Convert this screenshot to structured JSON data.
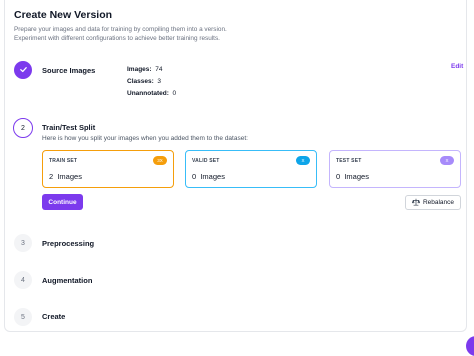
{
  "header": {
    "title": "Create New Version",
    "subtitle_line1": "Prepare your images and data for training by compiling them into a version.",
    "subtitle_line2": "Experiment with different configurations to achieve better training results."
  },
  "steps": {
    "source": {
      "name": "Source Images",
      "edit_label": "Edit",
      "stats": [
        {
          "label": "Images:",
          "value": "74"
        },
        {
          "label": "Classes:",
          "value": "3"
        },
        {
          "label": "Unannotated:",
          "value": "0"
        }
      ]
    },
    "split": {
      "number": "2",
      "name": "Train/Test Split",
      "description": "Here is how you split your images when you added them to the dataset:",
      "sets": [
        {
          "label": "TRAIN SET",
          "badge": "3X",
          "value": "2",
          "unit": "Images",
          "color": "#f59e0b",
          "badge_color": "#f59e0b"
        },
        {
          "label": "VALID SET",
          "badge": "X",
          "value": "0",
          "unit": "Images",
          "color": "#38bdf8",
          "badge_color": "#0ea5e9"
        },
        {
          "label": "TEST SET",
          "badge": "X",
          "value": "0",
          "unit": "Images",
          "color": "#c4b5fd",
          "badge_color": "#a78bfa"
        }
      ],
      "continue_label": "Continue",
      "rebalance_label": "Rebalance"
    },
    "preprocessing": {
      "number": "3",
      "name": "Preprocessing"
    },
    "augmentation": {
      "number": "4",
      "name": "Augmentation"
    },
    "create": {
      "number": "5",
      "name": "Create"
    }
  },
  "colors": {
    "accent": "#7c3aed"
  }
}
